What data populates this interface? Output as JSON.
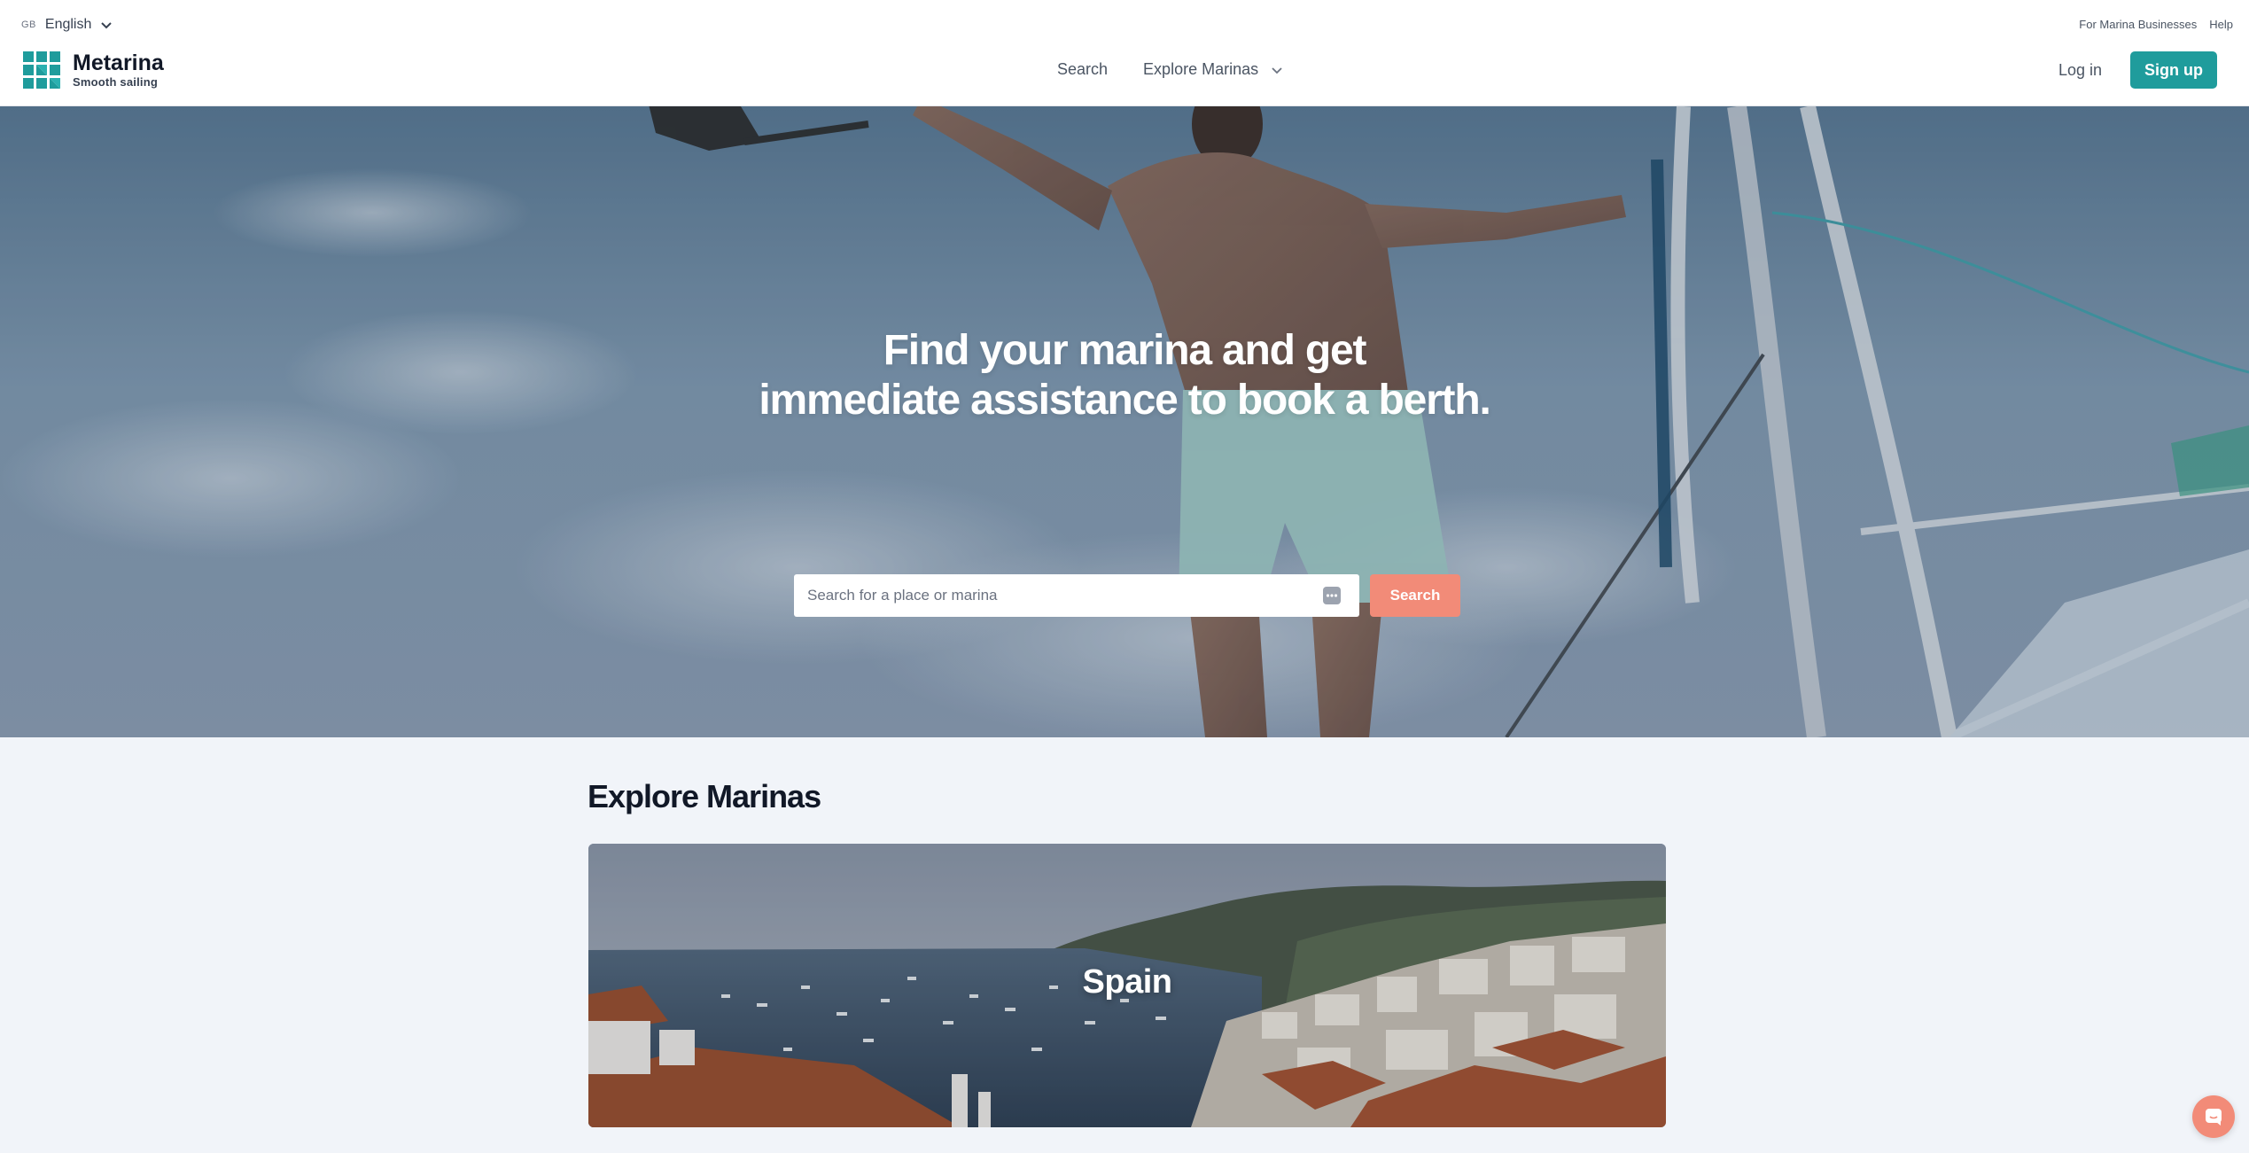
{
  "language": {
    "flag": "GB",
    "label": "English",
    "icon": "chevron-down-icon"
  },
  "utility_links": [
    "For Marina Businesses",
    "Help"
  ],
  "brand": {
    "name": "Metarina",
    "tagline": "Smooth sailing",
    "color": "#1f9c9c"
  },
  "nav": {
    "items": [
      {
        "label": "Search"
      },
      {
        "label": "Explore Marinas",
        "icon": "chevron-down-icon"
      }
    ],
    "login": "Log in",
    "signup": "Sign up"
  },
  "hero": {
    "title_line1": "Find your marina and get",
    "title_line2": "immediate assistance to book a berth.",
    "search_placeholder": "Search for a place or marina",
    "search_button": "Search",
    "accent": "#f28b78"
  },
  "explore": {
    "title": "Explore Marinas",
    "cards": [
      {
        "label": "Spain"
      }
    ]
  },
  "chat": {
    "icon": "chat-icon"
  }
}
